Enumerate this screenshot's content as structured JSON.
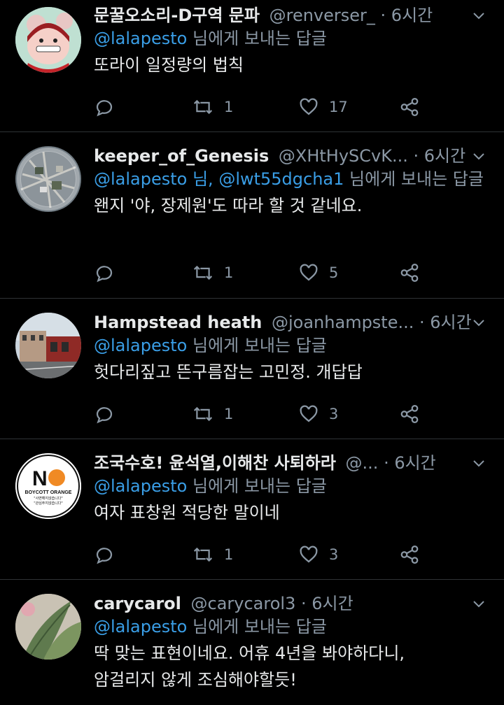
{
  "tweets": [
    {
      "name": "문꿀오소리-D구역 문파",
      "handle": "@renverser_",
      "time": "6시간",
      "reply_mentions": "@lalapesto",
      "reply_suffix": " 님에게 보내는 답글",
      "text": "또라이 일정량의 법칙",
      "retweets": "1",
      "likes": "17"
    },
    {
      "name": "keeper_of_Genesis",
      "handle": "@XHtHySCvK...",
      "time": "6시간",
      "reply_mentions": "@lalapesto 님, @lwt55dgcha1",
      "reply_suffix": " 님에게 보내는 답글",
      "text": "왠지 '야, 장제원'도 따라 할 것 같네요.",
      "retweets": "1",
      "likes": "5"
    },
    {
      "name": "Hampstead heath",
      "handle": "@joanhampste...",
      "time": "6시간",
      "reply_mentions": "@lalapesto",
      "reply_suffix": " 님에게 보내는 답글",
      "text": "헛다리짚고 뜬구름잡는 고민정. 개답답",
      "retweets": "1",
      "likes": "3"
    },
    {
      "name": "조국수호! 윤석열,이해찬 사퇴하라",
      "handle": "@...",
      "time": "6시간",
      "reply_mentions": "@lalapesto",
      "reply_suffix": " 님에게 보내는 답글",
      "text": "여자 표창원 적당한 말이네",
      "retweets": "1",
      "likes": "3",
      "avatar_text": {
        "big": "N",
        "line1": "BOYCOTT ORANGE",
        "line2": "\"사면해지않습니다\"",
        "line3": "\"관심주지않습니다\""
      }
    },
    {
      "name": "carycarol",
      "handle": "@carycarol3",
      "time": "6시간",
      "reply_mentions": "@lalapesto",
      "reply_suffix": " 님에게 보내는 답글",
      "text_line1": "딱 맞는 표현이네요. 어휴 4년을 봐야하다니,",
      "text_line2": "암걸리지 않게 조심해야할듯!"
    }
  ],
  "separator": " · ",
  "colors": {
    "background": "#000000",
    "link": "#3a9ee6",
    "muted": "#8b98a5",
    "text": "#e7e9ea",
    "divider": "#2f3336"
  },
  "icons": [
    "reply-icon",
    "retweet-icon",
    "like-icon",
    "share-icon",
    "chevron-down-icon"
  ]
}
